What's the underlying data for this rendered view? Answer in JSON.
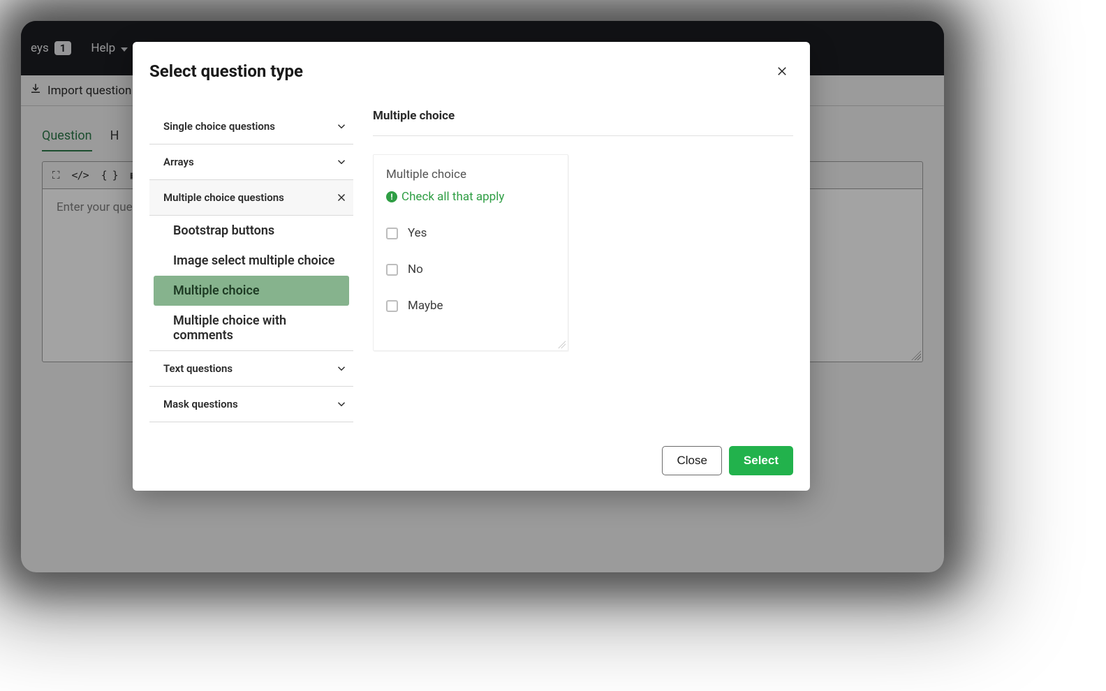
{
  "topnav": {
    "surveys_fragment": "eys",
    "surveys_count": "1",
    "help_label": "Help"
  },
  "toolbar": {
    "import_label": "Import question"
  },
  "tabs": {
    "question": "Question",
    "help_frag": "H"
  },
  "editor": {
    "placeholder": "Enter your questi"
  },
  "modal": {
    "title": "Select question type",
    "close_btn": "Close",
    "select_btn": "Select"
  },
  "categories": [
    {
      "label": "Single choice questions",
      "expanded": false
    },
    {
      "label": "Arrays",
      "expanded": false
    },
    {
      "label": "Multiple choice questions",
      "expanded": true,
      "items": [
        {
          "label": "Bootstrap buttons",
          "selected": false
        },
        {
          "label": "Image select multiple choice",
          "selected": false
        },
        {
          "label": "Multiple choice",
          "selected": true
        },
        {
          "label": "Multiple choice with comments",
          "selected": false
        }
      ]
    },
    {
      "label": "Text questions",
      "expanded": false
    },
    {
      "label": "Mask questions",
      "expanded": false
    }
  ],
  "preview": {
    "title": "Multiple choice",
    "card_heading": "Multiple choice",
    "hint": "Check all that apply",
    "options": [
      "Yes",
      "No",
      "Maybe"
    ]
  }
}
